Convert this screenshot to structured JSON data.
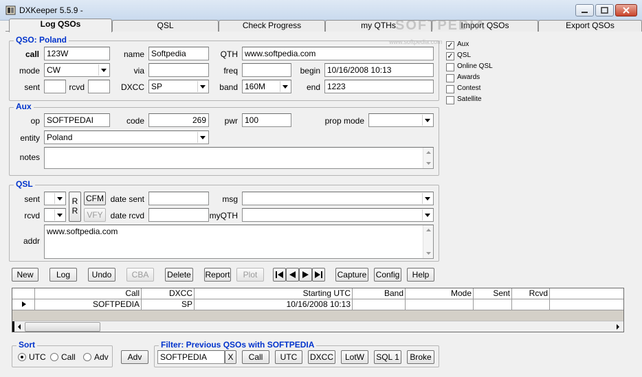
{
  "window": {
    "title": "DXKeeper 5.5.9 -"
  },
  "tabs": [
    {
      "label": "Log QSOs"
    },
    {
      "label": "QSL"
    },
    {
      "label": "Check Progress"
    },
    {
      "label": "my QTHs"
    },
    {
      "label": "Import QSOs"
    },
    {
      "label": "Export QSOs"
    }
  ],
  "watermark": "SOFTPEDIA",
  "watermark_url": "www.softpedia.com",
  "qso": {
    "title": "QSO: Poland",
    "call_label": "call",
    "call": "123W",
    "name_label": "name",
    "name": "Softpedia",
    "qth_label": "QTH",
    "qth": "www.softpedia.com",
    "mode_label": "mode",
    "mode": "CW",
    "via_label": "via",
    "via": "",
    "freq_label": "freq",
    "freq": "",
    "begin_label": "begin",
    "begin": "10/16/2008  10:13",
    "sent_label": "sent",
    "sent": "",
    "rcvd_label": "rcvd",
    "rcvd": "",
    "dxcc_label": "DXCC",
    "dxcc": "SP",
    "band_label": "band",
    "band": "160M",
    "end_label": "end",
    "end": "1223"
  },
  "options": [
    {
      "label": "Aux",
      "checked": true
    },
    {
      "label": "QSL",
      "checked": true
    },
    {
      "label": "Online QSL",
      "checked": false
    },
    {
      "label": "Awards",
      "checked": false
    },
    {
      "label": "Contest",
      "checked": false
    },
    {
      "label": "Satellite",
      "checked": false
    }
  ],
  "aux": {
    "title": "Aux",
    "op_label": "op",
    "op": "SOFTPEDAI",
    "code_label": "code",
    "code": "269",
    "pwr_label": "pwr",
    "pwr": "100",
    "propmode_label": "prop mode",
    "propmode": "",
    "entity_label": "entity",
    "entity": "Poland",
    "notes_label": "notes",
    "notes": ""
  },
  "qsl": {
    "title": "QSL",
    "sent_label": "sent",
    "rcvd_label": "rcvd",
    "rr_top": "R",
    "rr_bottom": "R",
    "cfm_label": "CFM",
    "vfy_label": "VFY",
    "datesent_label": "date sent",
    "datesent": "",
    "daterecvd_label": "date rcvd",
    "daterecvd": "",
    "msg_label": "msg",
    "msg": "",
    "myqth_label": "myQTH",
    "myqth": "",
    "addr_label": "addr",
    "addr": "www.softpedia.com"
  },
  "actions": [
    {
      "label": "New",
      "enabled": true
    },
    {
      "label": "Log",
      "enabled": true
    },
    {
      "label": "Undo",
      "enabled": true
    },
    {
      "label": "CBA",
      "enabled": false
    },
    {
      "label": "Delete",
      "enabled": true
    },
    {
      "label": "Report",
      "enabled": true
    },
    {
      "label": "Plot",
      "enabled": false
    },
    {
      "label": "Capture",
      "enabled": true
    },
    {
      "label": "Config",
      "enabled": true
    },
    {
      "label": "Help",
      "enabled": true
    }
  ],
  "grid": {
    "columns": [
      "Call",
      "DXCC",
      "Starting UTC",
      "Band",
      "Mode",
      "Sent",
      "Rcvd"
    ],
    "rows": [
      [
        "SOFTPEDIA",
        "SP",
        "10/16/2008  10:13",
        "",
        "",
        "",
        ""
      ]
    ]
  },
  "sort": {
    "title": "Sort",
    "options": [
      {
        "label": "UTC",
        "selected": true
      },
      {
        "label": "Call",
        "selected": false
      },
      {
        "label": "Adv",
        "selected": false
      }
    ],
    "adv_button": "Adv"
  },
  "filter": {
    "title": "Filter: Previous QSOs with SOFTPEDIA",
    "value": "SOFTPEDIA",
    "clear_label": "X",
    "buttons": [
      "Call",
      "UTC",
      "DXCC",
      "LotW",
      "SQL 1",
      "Broke"
    ]
  }
}
